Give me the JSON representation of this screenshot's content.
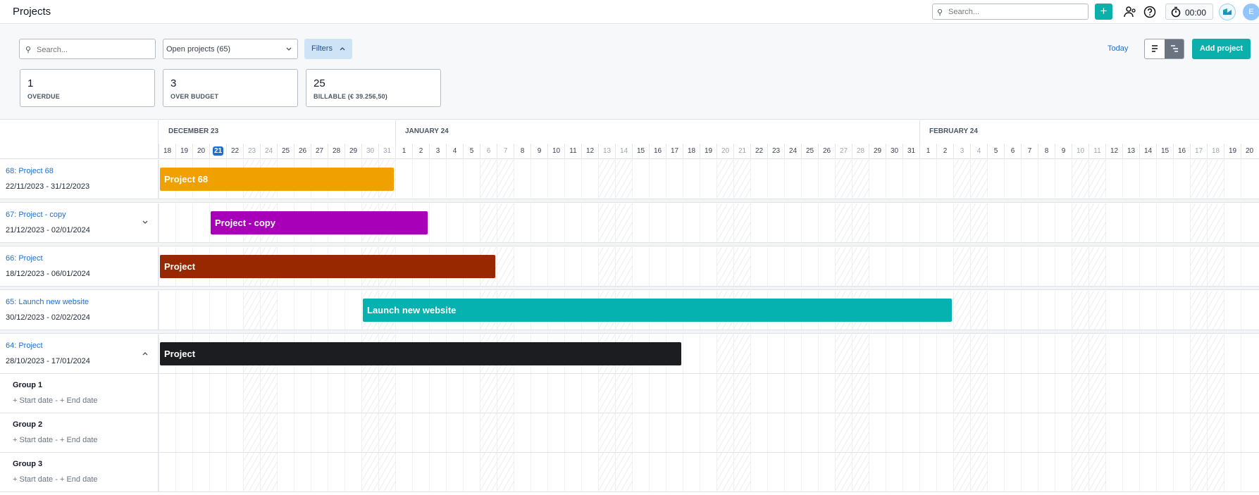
{
  "header": {
    "title": "Projects",
    "search_placeholder": "Search...",
    "add_label": "+",
    "timer": "00:00",
    "avatar_initial": "E"
  },
  "filters": {
    "search_placeholder": "Search...",
    "status_select": "Open projects (65)",
    "filters_label": "Filters",
    "today_label": "Today",
    "add_project_label": "Add project"
  },
  "stats": [
    {
      "value": "1",
      "label": "OVERDUE"
    },
    {
      "value": "3",
      "label": "OVER BUDGET"
    },
    {
      "value": "25",
      "label": "BILLABLE (€ 39.256,50)"
    }
  ],
  "timeline": {
    "months": [
      {
        "label": "DECEMBER 23",
        "start_index": 0
      },
      {
        "label": "JANUARY 24",
        "start_index": 14
      },
      {
        "label": "FEBRUARY 24",
        "start_index": 45
      }
    ],
    "days": [
      "18",
      "19",
      "20",
      "21",
      "22",
      "23",
      "24",
      "25",
      "26",
      "27",
      "28",
      "29",
      "30",
      "31",
      "1",
      "2",
      "3",
      "4",
      "5",
      "6",
      "7",
      "8",
      "9",
      "10",
      "11",
      "12",
      "13",
      "14",
      "15",
      "16",
      "17",
      "18",
      "19",
      "20",
      "21",
      "22",
      "23",
      "24",
      "25",
      "26",
      "27",
      "28",
      "29",
      "30",
      "31",
      "1",
      "2",
      "3",
      "4",
      "5",
      "6",
      "7",
      "8",
      "9",
      "10",
      "11",
      "12",
      "13",
      "14",
      "15",
      "16",
      "17",
      "18",
      "19",
      "20"
    ],
    "today_index": 3,
    "weekend_indices": [
      5,
      6,
      12,
      13,
      19,
      20,
      26,
      27,
      33,
      34,
      40,
      41,
      47,
      48,
      54,
      55,
      61,
      62
    ]
  },
  "projects": [
    {
      "link": "68: Project 68",
      "start": "22/11/2023",
      "end": "31/12/2023",
      "bar_label": "Project 68",
      "color": "#f0a000",
      "bar_start_index": 0,
      "bar_end_index": 14,
      "chevron": ""
    },
    {
      "link": "67: Project - copy",
      "start": "21/12/2023",
      "end": "02/01/2024",
      "bar_label": "Project - copy",
      "color": "#a800b8",
      "bar_start_index": 3,
      "bar_end_index": 16,
      "chevron": "down"
    },
    {
      "link": "66: Project",
      "start": "18/12/2023",
      "end": "06/01/2024",
      "bar_label": "Project",
      "color": "#982800",
      "bar_start_index": 0,
      "bar_end_index": 20,
      "chevron": ""
    },
    {
      "link": "65: Launch new website",
      "start": "30/12/2023",
      "end": "02/02/2024",
      "bar_label": "Launch new website",
      "color": "#06b2b0",
      "bar_start_index": 12,
      "bar_end_index": 47,
      "chevron": ""
    },
    {
      "link": "64: Project",
      "start": "28/10/2023",
      "end": "17/01/2024",
      "bar_label": "Project",
      "color": "#1c1d21",
      "bar_start_index": 0,
      "bar_end_index": 31,
      "chevron": "up"
    }
  ],
  "groups": [
    {
      "name": "Group 1",
      "start_label": "+ Start date",
      "end_label": "+ End date"
    },
    {
      "name": "Group 2",
      "start_label": "+ Start date",
      "end_label": "+ End date"
    },
    {
      "name": "Group 3",
      "start_label": "+ Start date",
      "end_label": "+ End date"
    }
  ],
  "dash": "-"
}
